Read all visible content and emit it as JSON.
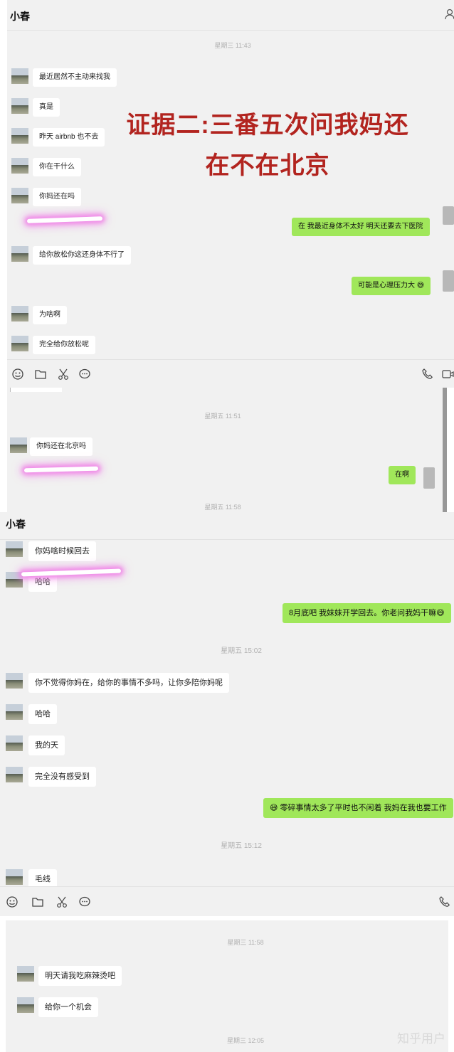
{
  "colors": {
    "overlay_red": "#b2241f",
    "my_bubble": "#a0e75a",
    "panel_bg": "#f1f1f1"
  },
  "icons": [
    "contact-icon",
    "emoji-icon",
    "folder-icon",
    "scissors-icon",
    "chat-icon",
    "phone-icon",
    "video-icon"
  ],
  "overlay": {
    "line1": "证据二:三番五次问我妈还",
    "line2": "在不在北京"
  },
  "panel1": {
    "title": "小春",
    "timestamp": "星期三 11:43",
    "messages": [
      "最近居然不主动来找我",
      "真是",
      "昨天 airbnb 也不去",
      "你在干什么",
      "你妈还在吗",
      "在 我最近身体不太好 明天还要去下医院",
      "给你放松你这还身体不行了",
      "可能是心理压力大 😅",
      "为啥啊",
      "完全给你放松呢"
    ]
  },
  "panel2": {
    "timestamp1": "星期五 11:51",
    "messages": [
      "你妈还在北京吗",
      "在啊"
    ],
    "timestamp2": "星期五 11:58"
  },
  "panel3": {
    "title": "小春",
    "timestamp1": "星期五 15:02",
    "timestamp2": "星期五 15:12",
    "messages": [
      "你妈啥时候回去",
      "哈哈",
      "8月底吧 我妹妹开学回去。你老问我妈干嘛😅",
      "你不觉得你妈在，给你的事情不多吗，让你多陪你妈呢",
      "哈哈",
      "我的天",
      "完全没有感受到",
      "😅 零碎事情太多了平时也不闲着 我妈在我也要工作",
      "毛线"
    ]
  },
  "panel4": {
    "timestamp1": "星期三 11:58",
    "messages": [
      "明天请我吃麻辣烫吧",
      "给你一个机会"
    ],
    "timestamp2": "星期三 12:05"
  },
  "watermark": "知乎用户"
}
